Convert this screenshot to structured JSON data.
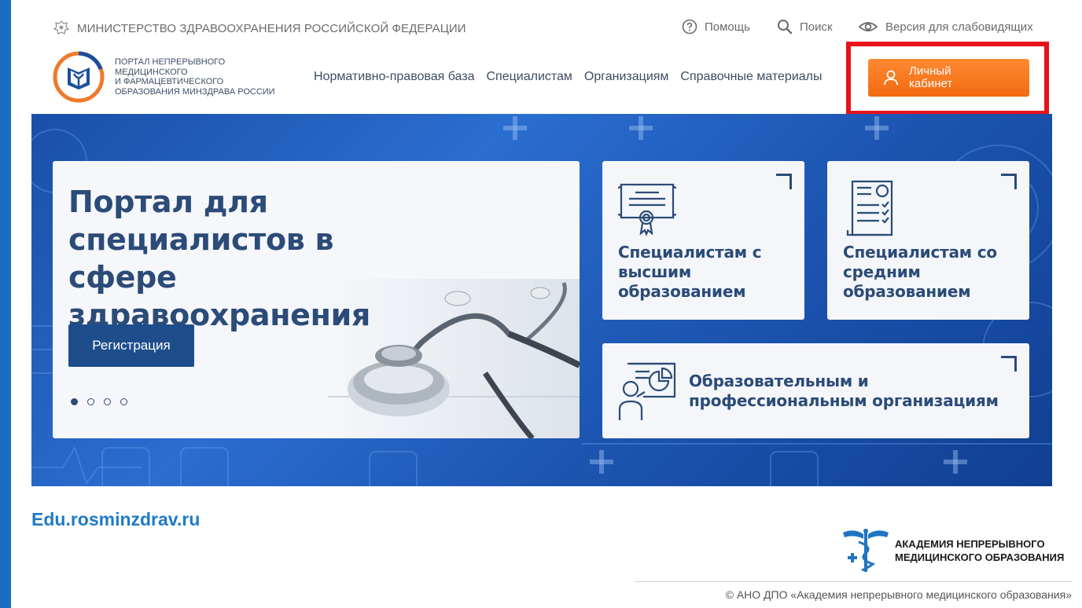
{
  "header": {
    "ministry": "МИНИСТЕРСТВО ЗДРАВООХРАНЕНИЯ РОССИЙСКОЙ ФЕДЕРАЦИИ",
    "help": "Помощь",
    "search": "Поиск",
    "accessibility": "Версия для слабовидящих"
  },
  "logo": {
    "lines": [
      "ПОРТАЛ НЕПРЕРЫВНОГО",
      "МЕДИЦИНСКОГО",
      "И ФАРМАЦЕВТИЧЕСКОГО",
      "ОБРАЗОВАНИЯ МИНЗДРАВА РОССИИ"
    ]
  },
  "nav": {
    "items": [
      "Нормативно-правовая база",
      "Специалистам",
      "Организациям",
      "Справочные материалы"
    ]
  },
  "cabinet_button": "Личный кабинет",
  "hero": {
    "title": "Портал для специалистов в сфере здравоохранения",
    "register_button": "Регистрация",
    "slides_count": 4,
    "active_slide": 1
  },
  "tiles": {
    "higher": "Специалистам с высшим образованием",
    "secondary": "Специалистам со средним образованием",
    "organizations": "Образовательным и профессиональным организациям"
  },
  "footer": {
    "url": "Edu.rosminzdrav.ru",
    "academy_line1": "АКАДЕМИЯ НЕПРЕРЫВНОГО",
    "academy_line2": "МЕДИЦИНСКОГО ОБРАЗОВАНИЯ",
    "copyright": "© АНО ДПО «Академия непрерывного медицинского образования»"
  },
  "colors": {
    "accent_orange": "#f27a20",
    "highlight_red": "#e8121c",
    "brand_blue": "#2b4b78",
    "hero_blue": "#1e5fc0",
    "url_blue": "#1f7ac7"
  }
}
